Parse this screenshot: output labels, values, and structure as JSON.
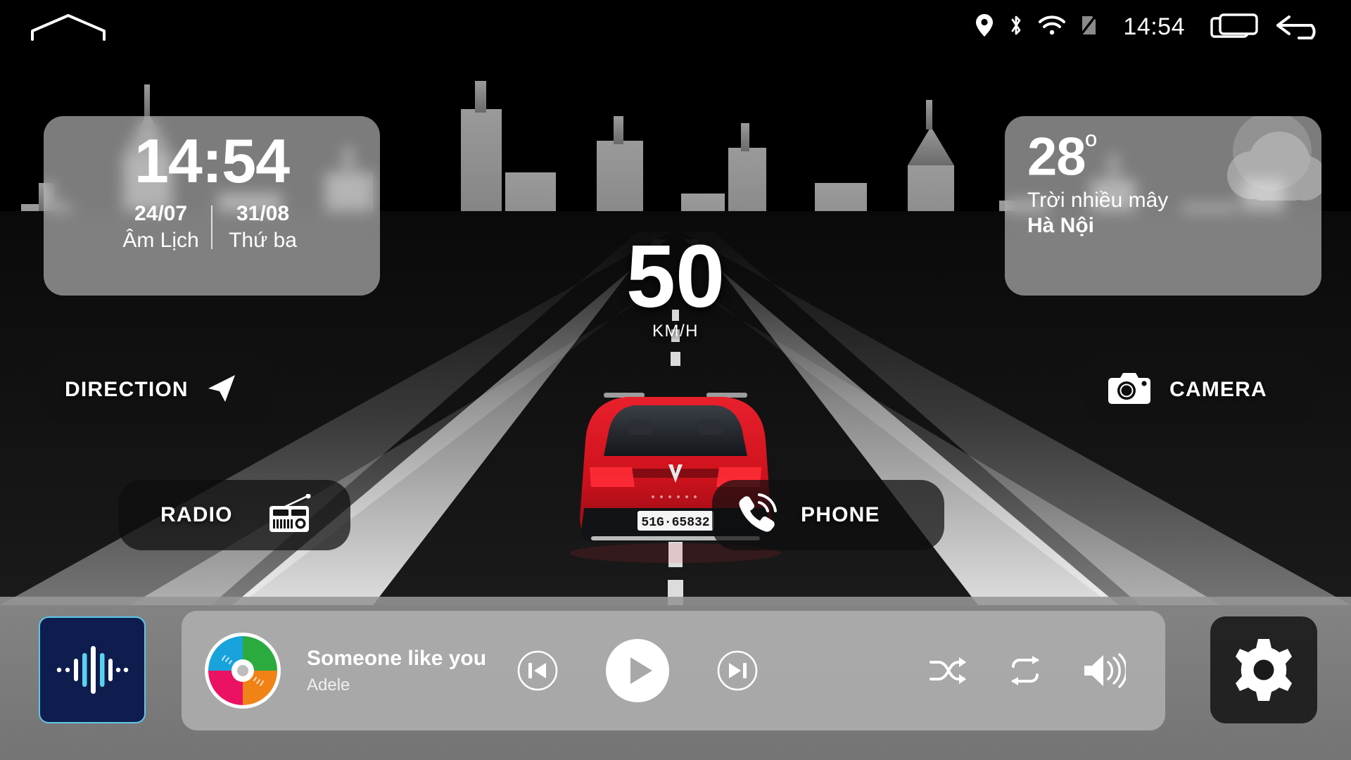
{
  "statusbar": {
    "home_icon": "home-icon",
    "icons": [
      "location-pin-icon",
      "bluetooth-icon",
      "wifi-icon",
      "sim-off-icon"
    ],
    "time": "14:54",
    "recents_icon": "recent-apps-icon",
    "back_icon": "back-arrow-icon"
  },
  "clock_widget": {
    "time": "14:54",
    "solar_date": "24/07",
    "gregorian_date": "31/08",
    "solar_label": "Âm Lịch",
    "weekday_label": "Thứ ba"
  },
  "weather_widget": {
    "temperature": "28",
    "degree": "º",
    "condition": "Trời nhiều mây",
    "city": "Hà Nội",
    "icon": "cloud-icon"
  },
  "speed": {
    "value": "50",
    "unit": "KM/H"
  },
  "shortcuts": [
    {
      "id": "direction",
      "label": "DIRECTION",
      "icon": "navigation-arrow-icon"
    },
    {
      "id": "camera",
      "label": "CAMERA",
      "icon": "camera-icon"
    },
    {
      "id": "radio",
      "label": "RADIO",
      "icon": "radio-icon"
    },
    {
      "id": "phone",
      "label": "PHONE",
      "icon": "phone-call-icon"
    }
  ],
  "vehicle": {
    "license_plate": "51G-65832",
    "body_color": "#d4141e"
  },
  "dock": {
    "voice_assistant_icon": "voice-waveform-icon",
    "settings_icon": "gear-icon",
    "media": {
      "album_art_icon": "cd-disc-icon",
      "track_title": "Someone like you",
      "track_artist": "Adele",
      "previous_icon": "skip-previous-icon",
      "play_icon": "play-icon",
      "next_icon": "skip-next-icon",
      "shuffle_icon": "shuffle-icon",
      "repeat_icon": "repeat-icon",
      "volume_icon": "volume-up-icon"
    }
  },
  "colors": {
    "accent_blue": "#0e1d4e",
    "accent_cyan": "#5bc8e8",
    "car_red": "#d4141e",
    "glass": "#c8c8c8",
    "dock_gray": "#969696"
  }
}
